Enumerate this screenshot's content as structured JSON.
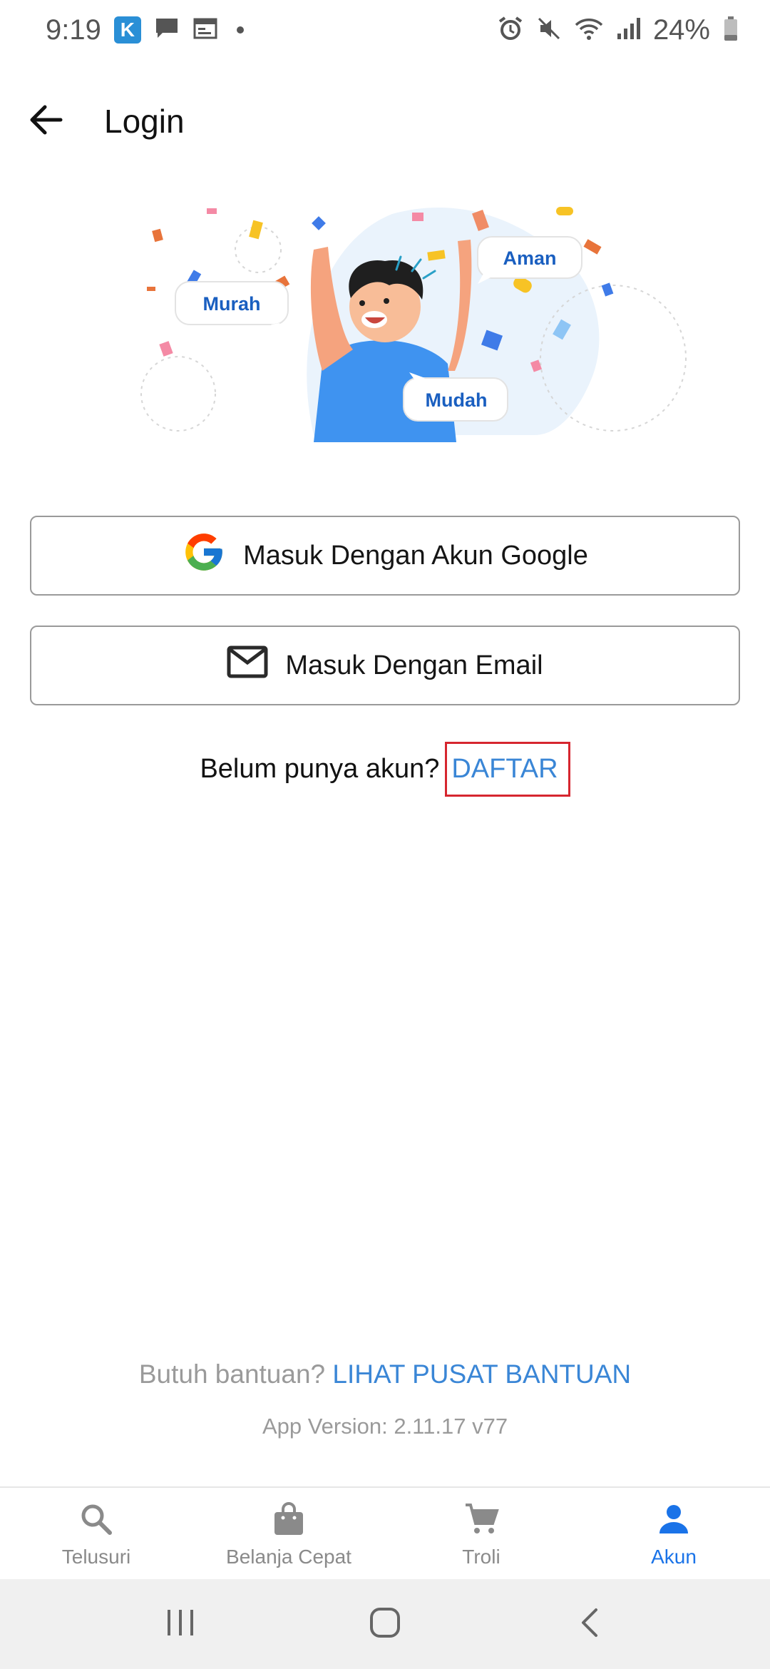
{
  "status_bar": {
    "time": "9:19",
    "app_badge": "K",
    "battery_percent": "24%"
  },
  "app_bar": {
    "title": "Login"
  },
  "hero": {
    "bubbles": [
      "Murah",
      "Aman",
      "Mudah"
    ]
  },
  "buttons": {
    "google_label": "Masuk Dengan Akun Google",
    "email_label": "Masuk Dengan Email"
  },
  "register": {
    "prompt": "Belum punya akun?",
    "link": "DAFTAR"
  },
  "help": {
    "prompt": "Butuh bantuan?",
    "link": "LIHAT PUSAT BANTUAN"
  },
  "version": "App Version: 2.11.17 v77",
  "bottom_nav": {
    "items": [
      {
        "label": "Telusuri",
        "icon": "search-icon"
      },
      {
        "label": "Belanja Cepat",
        "icon": "shopping-bag-icon"
      },
      {
        "label": "Troli",
        "icon": "cart-icon"
      },
      {
        "label": "Akun",
        "icon": "account-icon"
      }
    ],
    "active_index": 3
  },
  "colors": {
    "accent": "#3a86d6",
    "nav_active": "#1a73e8",
    "highlight_box": "#d6262f"
  }
}
